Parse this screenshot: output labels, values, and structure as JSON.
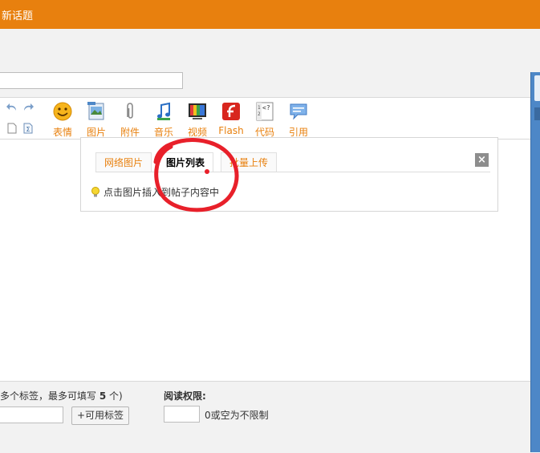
{
  "header": {
    "title": "新话题"
  },
  "toolbar": {
    "tools": [
      {
        "icon": "smiley-icon",
        "label": "表情"
      },
      {
        "icon": "image-icon",
        "label": "图片"
      },
      {
        "icon": "paperclip-icon",
        "label": "附件"
      },
      {
        "icon": "music-note-icon",
        "label": "音乐"
      },
      {
        "icon": "video-icon",
        "label": "视频"
      },
      {
        "icon": "flash-icon",
        "label": "Flash"
      },
      {
        "icon": "code-icon",
        "label": "代码"
      },
      {
        "icon": "quote-icon",
        "label": "引用"
      }
    ]
  },
  "image_popup": {
    "tabs": [
      "网络图片",
      "图片列表",
      "批量上传"
    ],
    "active_tab": "图片列表",
    "hint": "点击图片插入到帖子内容中",
    "close_label": "×"
  },
  "tags": {
    "hint_prefix": "多个标签，最多可填写 ",
    "hint_count": "5",
    "hint_suffix": " 个)",
    "button_label": "+可用标签"
  },
  "read_permission": {
    "label": "阅读权限:",
    "hint": "0或空为不限制"
  },
  "colors": {
    "accent": "#e8800e",
    "annotation": "#e8202a",
    "side_strip": "#4d87c7"
  }
}
